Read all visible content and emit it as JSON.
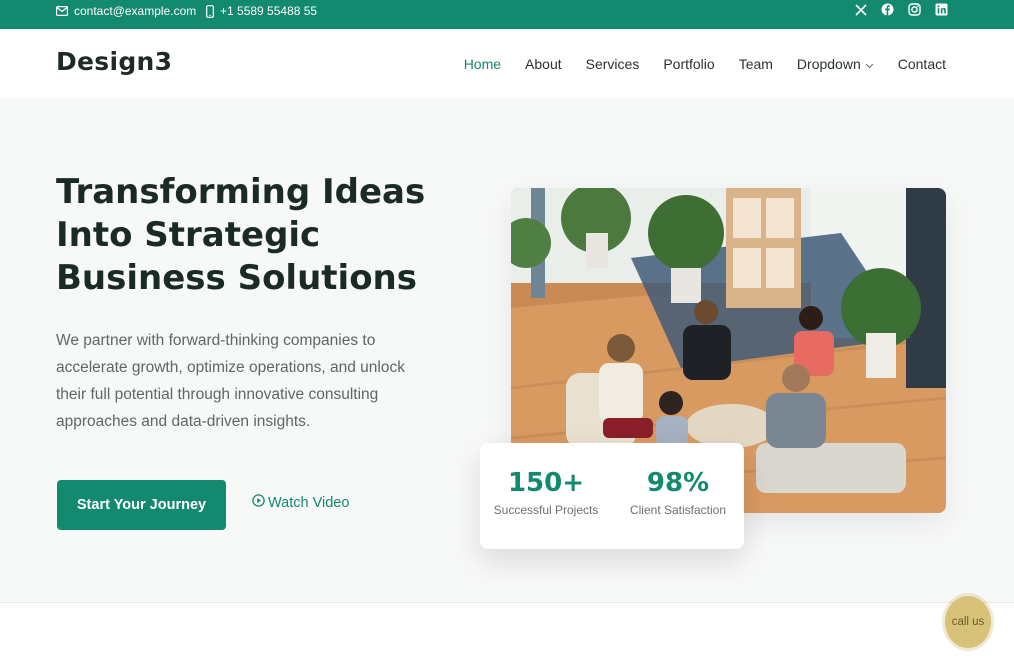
{
  "topbar": {
    "email": "contact@example.com",
    "phone": "+1 5589 55488 55",
    "socials": [
      "x-icon",
      "facebook-icon",
      "instagram-icon",
      "linkedin-icon"
    ]
  },
  "header": {
    "logo": "Design3",
    "nav": [
      {
        "label": "Home",
        "active": true
      },
      {
        "label": "About"
      },
      {
        "label": "Services"
      },
      {
        "label": "Portfolio"
      },
      {
        "label": "Team"
      },
      {
        "label": "Dropdown"
      },
      {
        "label": "Contact"
      }
    ]
  },
  "hero": {
    "title": "Transforming Ideas Into Strategic Business Solutions",
    "description": "We partner with forward-thinking companies to accelerate growth, optimize operations, and unlock their full potential through innovative consulting approaches and data-driven insights.",
    "cta_label": "Start Your Journey",
    "video_label": "Watch Video"
  },
  "stats": [
    {
      "value": "150+",
      "label": "Successful Projects"
    },
    {
      "value": "98%",
      "label": "Client Satisfaction"
    }
  ],
  "callus": "call us",
  "colors": {
    "brand": "#13896f",
    "callus": "#d8c27a"
  }
}
